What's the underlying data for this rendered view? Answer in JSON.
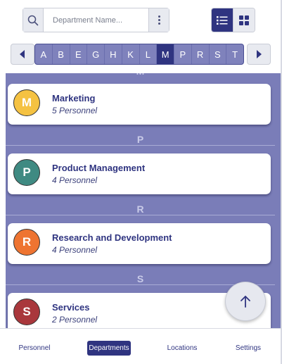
{
  "search": {
    "placeholder": "Department Name...",
    "value": ""
  },
  "view_toggle": {
    "active": "list"
  },
  "alphabet": {
    "letters": [
      "A",
      "B",
      "E",
      "G",
      "H",
      "K",
      "L",
      "M",
      "P",
      "R",
      "S",
      "T"
    ],
    "active": "M"
  },
  "list": {
    "partial_header": "M",
    "sections": [
      {
        "letter": "P"
      },
      {
        "letter": "R"
      },
      {
        "letter": "S"
      }
    ],
    "cards": [
      {
        "initial": "M",
        "name": "Marketing",
        "count": "5 Personnel",
        "color": "#f5c242"
      },
      {
        "initial": "P",
        "name": "Product Management",
        "count": "4 Personnel",
        "color": "#3f8a82"
      },
      {
        "initial": "R",
        "name": "Research and Development",
        "count": "4 Personnel",
        "color": "#ee7431"
      },
      {
        "initial": "S",
        "name": "Services",
        "count": "2 Personnel",
        "color": "#a9373c"
      }
    ]
  },
  "fab": {
    "icon": "arrow-up-icon"
  },
  "nav": {
    "items": [
      "Personnel",
      "Departments",
      "Locations",
      "Settings"
    ],
    "active": "Departments"
  },
  "colors": {
    "primary": "#2f3480",
    "list_bg": "#7a7db8",
    "alpha_bg": "#7f82bc"
  }
}
